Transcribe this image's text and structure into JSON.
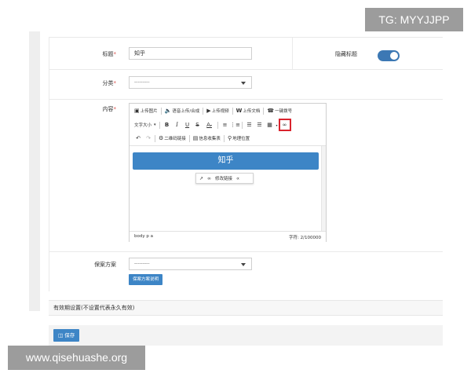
{
  "watermarks": {
    "tg": "TG: MYYJJPP",
    "url": "www.qisehuashe.org"
  },
  "form": {
    "title_label": "标题",
    "required_mark": "*",
    "title_value": "知乎",
    "hide_title_label": "隐藏标题",
    "hide_title_on": true,
    "category_label": "分类",
    "category_selected": "---------",
    "content_label": "内容",
    "scheme_label": "保案方案",
    "scheme_selected": "---------",
    "scheme_help_button": "保案方案说明"
  },
  "editor": {
    "toolbar_row1": {
      "upload_image": "上传图片",
      "voice_upload": "语音上传/合成",
      "upload_video": "上传视频",
      "upload_doc": "上传文档",
      "one_key_dial": "一键拨号"
    },
    "toolbar_row2": {
      "font_size": "文字大小",
      "bold": "B",
      "italic": "I",
      "underline": "U",
      "strike": "S",
      "font_color": "A"
    },
    "toolbar_row3": {
      "qr_link": "二维码链接",
      "info_collect": "信息收集表",
      "location": "地理位置"
    },
    "content_block_text": "知乎",
    "link_popup": {
      "edit_link": "修改链接"
    },
    "status_path": "body  p  a",
    "char_count": "字符: 2/100000"
  },
  "validity_section_title": "有效期设置(不设置代表永久有效)",
  "footer": {
    "save_label": "保存"
  },
  "icons": {
    "image": "image-icon",
    "voice": "speaker-icon",
    "video": "video-icon",
    "doc": "word-doc-icon",
    "phone": "phone-icon",
    "link": "link-icon",
    "save": "floppy-icon"
  },
  "colors": {
    "accent": "#3d85c6",
    "highlight": "#d9232d",
    "toggle": "#3c78b4"
  }
}
